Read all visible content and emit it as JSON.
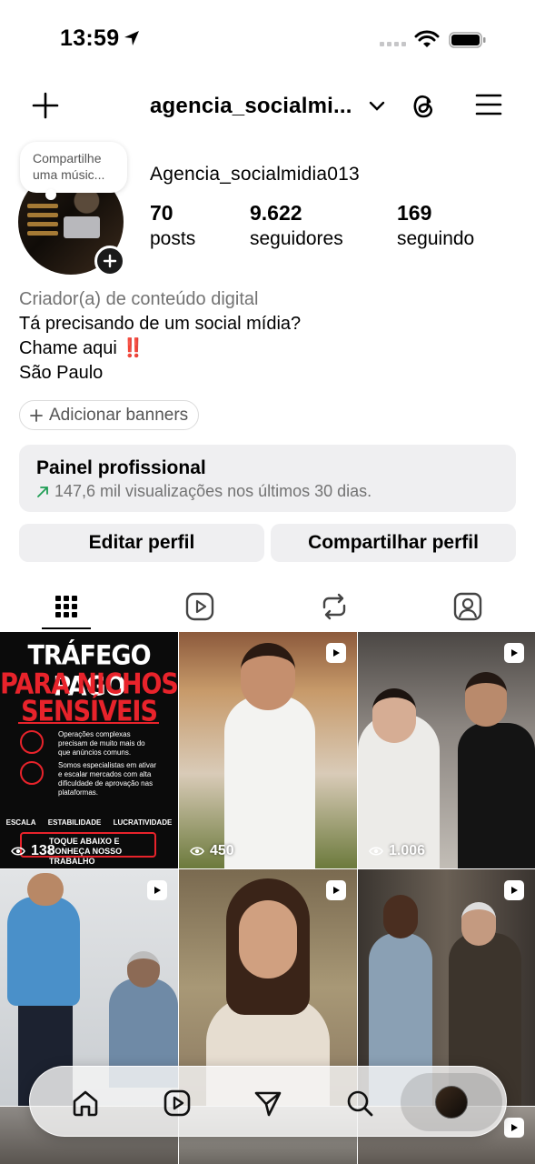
{
  "status_bar": {
    "time": "13:59"
  },
  "header": {
    "username": "agencia_socialmi..."
  },
  "profile": {
    "note": "Compartilhe uma músic...",
    "display_name": "Agencia_socialmidia013",
    "stats": [
      {
        "value": "70",
        "label": "posts"
      },
      {
        "value": "9.622",
        "label": "seguidores"
      },
      {
        "value": "169",
        "label": "seguindo"
      }
    ],
    "category": "Criador(a) de conteúdo digital",
    "bio_line1": "Tá precisando de um social mídia?",
    "bio_line2": "Chame aqui",
    "bio_emoji": "‼️",
    "location": "São Paulo",
    "add_banners": "Adicionar banners"
  },
  "dashboard": {
    "title": "Painel profissional",
    "subtitle": "147,6 mil visualizações nos últimos 30 dias."
  },
  "actions": {
    "edit": "Editar perfil",
    "share": "Compartilhar perfil"
  },
  "posts": {
    "p1_title1": "TRÁFEGO PAGO",
    "p1_title2": "PARA NICHOS",
    "p1_title3": "SENSÍVEIS",
    "p1_item1": "Operações complexas precisam de muito mais do que anúncios comuns.",
    "p1_item2": "Somos especialistas em ativar e escalar mercados com alta dificuldade de aprovação nas plataformas.",
    "p1_l1": "ESCALA",
    "p1_l2": "ESTABILIDADE",
    "p1_l3": "LUCRATIVIDADE",
    "p1_cta": "TOQUE ABAIXO E CONHEÇA NOSSO TRABALHO",
    "views": [
      "138",
      "450",
      "1.006"
    ]
  },
  "icons": {
    "grid": "grid-icon",
    "reels": "reels-icon",
    "reposts": "repost-icon",
    "tagged": "tagged-icon",
    "home": "home-icon",
    "send": "send-icon",
    "search": "search-icon"
  }
}
